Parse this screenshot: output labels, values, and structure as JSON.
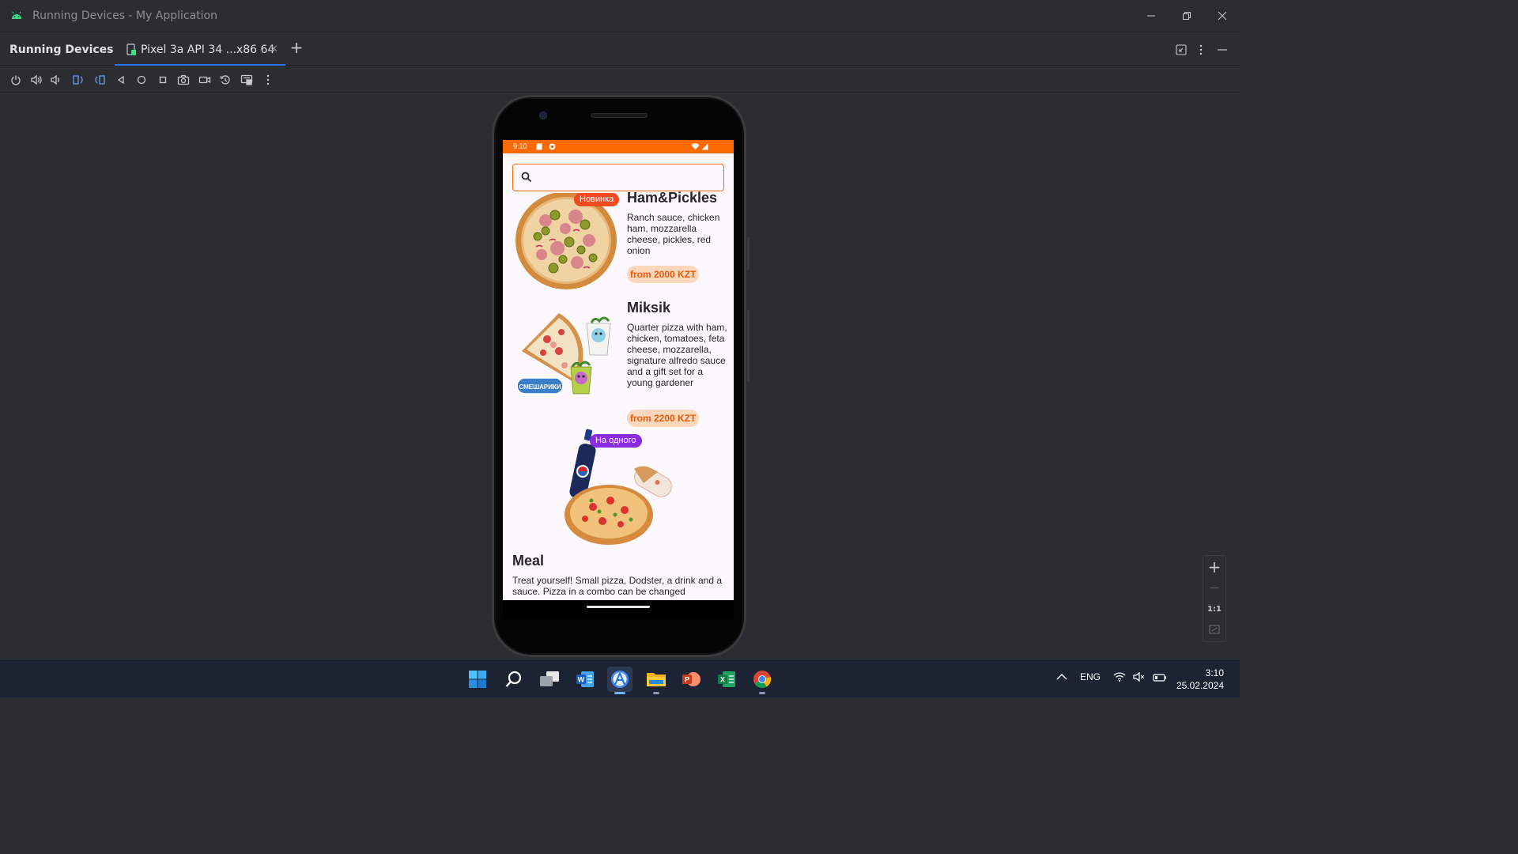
{
  "window": {
    "title": "Running Devices - My Application"
  },
  "tool_window": {
    "title": "Running Devices",
    "device_tab_label": "Pixel 3a API 34 ...x86 64",
    "add_tab_label": "+"
  },
  "toolbar_icons": [
    "power-icon",
    "volume-up-icon",
    "volume-down-icon",
    "rotate-left-icon",
    "rotate-right-icon",
    "back-icon",
    "home-icon",
    "overview-icon",
    "screenshot-icon",
    "screen-record-icon",
    "reset-icon",
    "device-frame-icon",
    "more-icon"
  ],
  "phone": {
    "status_time": "9:10",
    "search": {
      "placeholder": ""
    },
    "items": [
      {
        "badge": "Новинка",
        "badge_color": "#f24a21",
        "title": "Ham&Pickles",
        "description": "Ranch sauce, chicken ham, mozzarella cheese, pickles, red onion",
        "price": "from 2000 KZT"
      },
      {
        "badge": "",
        "title": "Miksik",
        "description": "Quarter pizza with ham, chicken, tomatoes, feta cheese, mozzarella, signature alfredo sauce and a gift set for a young gardener",
        "price": "from 2200 KZT",
        "image_logo_text": "СМЕШАРИКИ"
      },
      {
        "badge": "На одного",
        "badge_color": "#8b2be2",
        "title": "Meal",
        "description": "Treat yourself! Small pizza, Dodster, a drink and a sauce. Pizza in a combo can be changed"
      }
    ]
  },
  "zoom_controls": {
    "zoom_in": "+",
    "zoom_out": "—",
    "actual_size": "1:1"
  },
  "taskbar": {
    "apps": [
      "windows-start-icon",
      "search-icon",
      "task-view-icon",
      "word-icon",
      "android-studio-icon",
      "file-explorer-icon",
      "powerpoint-icon",
      "excel-icon",
      "chrome-icon"
    ],
    "language": "ENG",
    "time": "3:10",
    "date": "25.02.2024"
  },
  "colors": {
    "accent_orange": "#fb6a02",
    "ide_background": "#2b2d30",
    "tab_underline": "#3574f0"
  }
}
